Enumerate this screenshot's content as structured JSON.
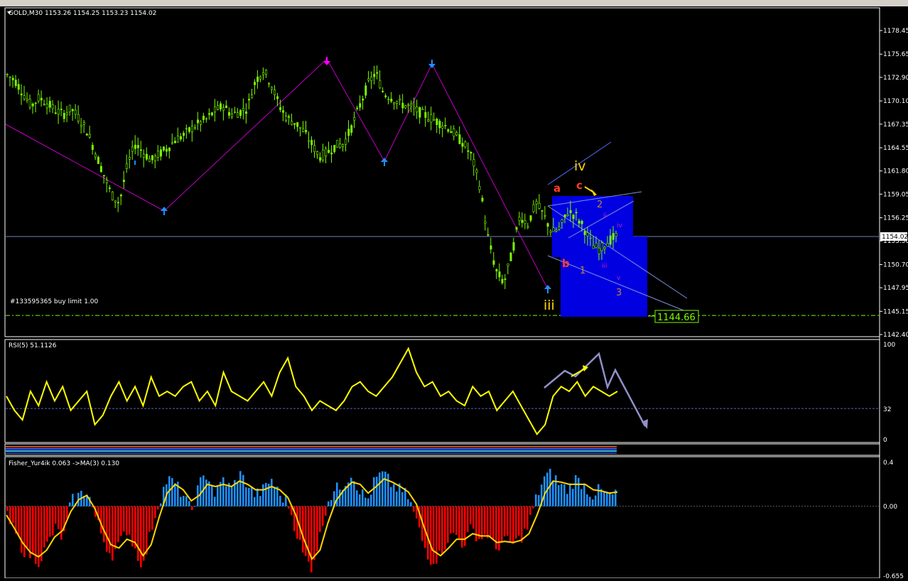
{
  "window": {
    "symbol_info": "GOLD,M30  1153.26 1154.25 1153.23 1154.02",
    "order_label": "#133595365 buy limit 1.00",
    "price_tag": "1154.02",
    "limit_tag": "1144.66"
  },
  "panels": {
    "rsi_label": "RSI(5) 51.1126",
    "fisher_label": "Fisher_Yur4ik 0.063  ->MA(3) 0.130"
  },
  "wave_labels": {
    "iv": "iv",
    "iii": "iii",
    "a": "a",
    "b": "b",
    "c": "c",
    "n1": "1",
    "n2": "2",
    "n3": "3",
    "sub_ii": "ii",
    "sub_iii": "iii",
    "sub_iv": "iv",
    "sub_v": "v"
  },
  "colors": {
    "background": "#000000",
    "bull_candle": "#7CFC00",
    "rsi_line": "#FFFF00",
    "fisher_up": "#1E90FF",
    "fisher_down": "#FF0000",
    "fisher_ma": "#FFD700",
    "zigzag": "#C000C0",
    "box": "#0000E0",
    "grid_text": "#FFFFFF"
  },
  "chart_data": [
    {
      "type": "candlestick",
      "title": "GOLD,M30",
      "ylim": [
        1142.4,
        1180.0
      ],
      "y_ticks": [
        "1178.45",
        "1175.65",
        "1172.90",
        "1170.10",
        "1167.35",
        "1164.55",
        "1161.80",
        "1159.05",
        "1156.25",
        "1153.50",
        "1150.70",
        "1147.95",
        "1145.15",
        "1142.40"
      ],
      "price_path": [
        1173.2,
        1172.5,
        1171.0,
        1169.5,
        1170.5,
        1169.8,
        1169.0,
        1168.5,
        1169.2,
        1168.0,
        1166.5,
        1164.0,
        1161.5,
        1159.0,
        1158.0,
        1162.5,
        1165.0,
        1164.0,
        1163.0,
        1163.8,
        1164.5,
        1165.5,
        1166.0,
        1166.8,
        1167.5,
        1168.0,
        1169.0,
        1169.5,
        1168.5,
        1168.8,
        1169.3,
        1172.5,
        1173.8,
        1172.0,
        1169.5,
        1168.0,
        1167.5,
        1166.5,
        1165.0,
        1163.5,
        1164.0,
        1164.8,
        1165.0,
        1167.0,
        1169.5,
        1172.0,
        1173.5,
        1171.0,
        1170.5,
        1169.8,
        1169.5,
        1169.0,
        1168.5,
        1168.0,
        1167.5,
        1167.0,
        1166.0,
        1165.0,
        1163.5,
        1160.0,
        1154.0,
        1150.0,
        1148.5,
        1152.0,
        1156.5,
        1155.5,
        1158.0,
        1156.5,
        1154.5,
        1155.0,
        1157.0,
        1156.5,
        1155.0,
        1153.0,
        1152.5,
        1153.5,
        1154.0
      ],
      "current_price": 1154.02,
      "buy_limit": 1144.66
    },
    {
      "type": "line",
      "title": "RSI(5)",
      "ylim": [
        0,
        100
      ],
      "y_ticks": [
        "100",
        "32",
        "0"
      ],
      "level": 32,
      "values": [
        45,
        30,
        20,
        50,
        35,
        60,
        40,
        55,
        30,
        40,
        50,
        15,
        25,
        45,
        60,
        40,
        55,
        35,
        65,
        45,
        50,
        45,
        55,
        60,
        40,
        50,
        35,
        70,
        50,
        45,
        40,
        50,
        60,
        45,
        70,
        85,
        55,
        45,
        30,
        40,
        35,
        30,
        40,
        55,
        60,
        50,
        45,
        55,
        65,
        80,
        95,
        70,
        55,
        60,
        45,
        50,
        40,
        35,
        55,
        45,
        50,
        30,
        40,
        50,
        35,
        20,
        5,
        15,
        45,
        55,
        50,
        60,
        45,
        55,
        50,
        45,
        50
      ]
    },
    {
      "type": "bar",
      "title": "Fisher_Yur4ik",
      "ylim": [
        -0.655,
        0.4
      ],
      "y_ticks": [
        "0.4",
        "0.00",
        "-0.655"
      ],
      "values": [
        -0.1,
        -0.25,
        -0.4,
        -0.45,
        -0.5,
        -0.35,
        -0.2,
        -0.3,
        0.05,
        0.1,
        0.15,
        -0.1,
        -0.3,
        -0.45,
        -0.35,
        -0.2,
        -0.4,
        -0.55,
        -0.2,
        0.05,
        0.25,
        0.2,
        0.1,
        -0.05,
        0.2,
        0.3,
        0.1,
        0.25,
        0.15,
        0.3,
        0.2,
        0.1,
        0.15,
        0.25,
        0.1,
        0.05,
        -0.2,
        -0.45,
        -0.55,
        -0.3,
        0.05,
        0.15,
        0.2,
        0.3,
        0.15,
        0.05,
        0.25,
        0.3,
        0.2,
        0.15,
        0.1,
        -0.1,
        -0.35,
        -0.5,
        -0.45,
        -0.3,
        -0.25,
        -0.35,
        -0.2,
        -0.3,
        -0.25,
        -0.4,
        -0.3,
        -0.35,
        -0.3,
        -0.2,
        0.05,
        0.25,
        0.3,
        0.2,
        0.15,
        0.25,
        0.2,
        0.1,
        0.15,
        0.1,
        0.1
      ],
      "ma": [
        -0.08,
        -0.2,
        -0.33,
        -0.42,
        -0.46,
        -0.4,
        -0.28,
        -0.22,
        -0.05,
        0.06,
        0.1,
        -0.02,
        -0.2,
        -0.35,
        -0.38,
        -0.3,
        -0.33,
        -0.45,
        -0.35,
        -0.1,
        0.12,
        0.2,
        0.15,
        0.05,
        0.1,
        0.2,
        0.18,
        0.2,
        0.18,
        0.23,
        0.2,
        0.15,
        0.15,
        0.18,
        0.15,
        0.08,
        -0.08,
        -0.3,
        -0.48,
        -0.4,
        -0.15,
        0.05,
        0.15,
        0.22,
        0.2,
        0.12,
        0.18,
        0.25,
        0.22,
        0.18,
        0.13,
        0.02,
        -0.2,
        -0.4,
        -0.45,
        -0.38,
        -0.3,
        -0.3,
        -0.25,
        -0.27,
        -0.27,
        -0.33,
        -0.32,
        -0.33,
        -0.31,
        -0.25,
        -0.08,
        0.12,
        0.23,
        0.22,
        0.2,
        0.2,
        0.2,
        0.15,
        0.14,
        0.12,
        0.13
      ]
    }
  ]
}
